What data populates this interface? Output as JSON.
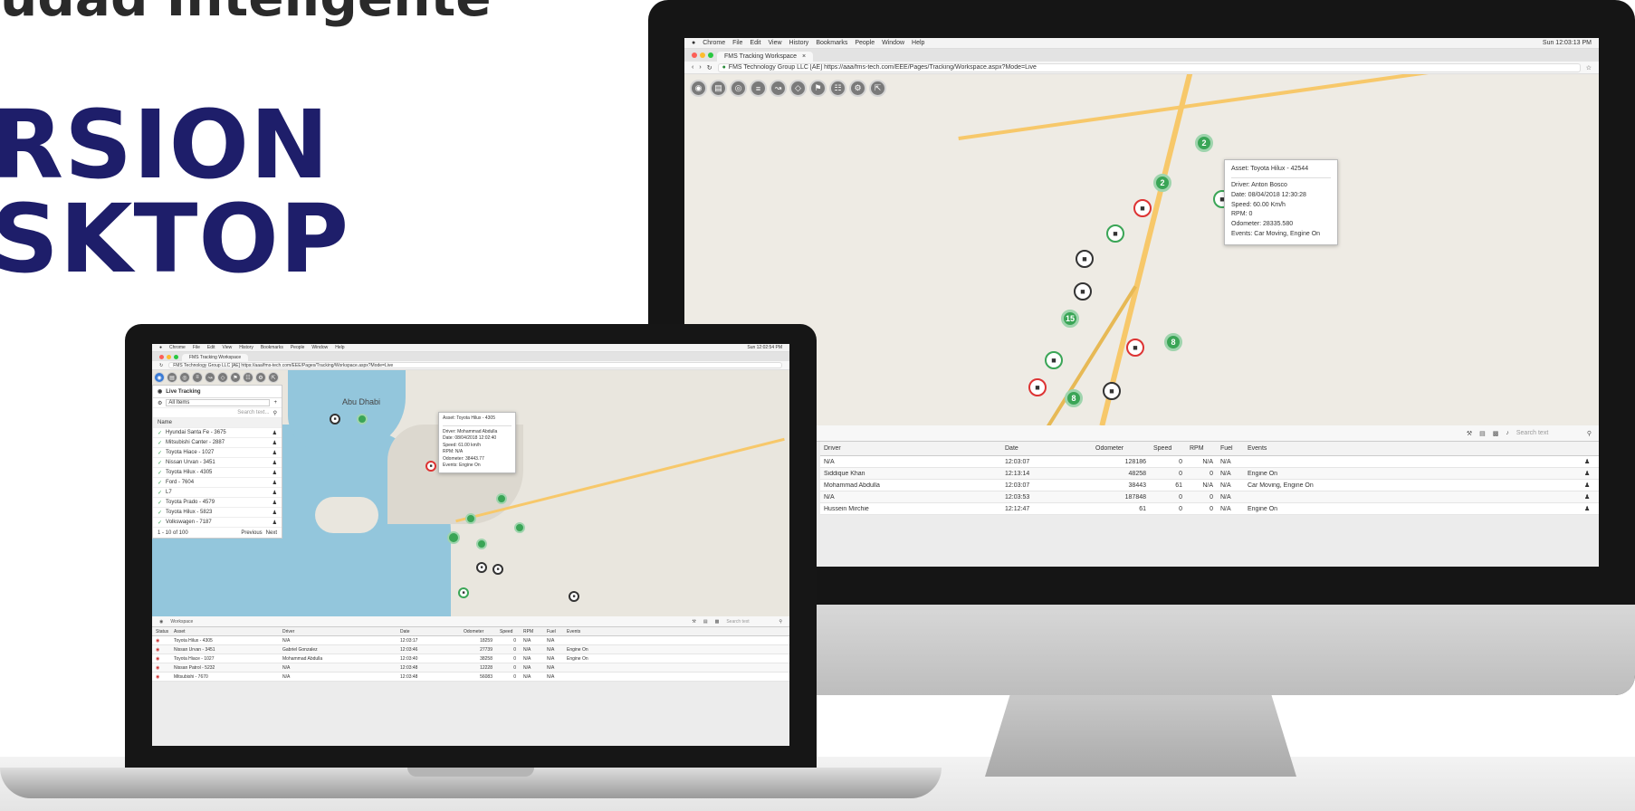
{
  "hero": {
    "top_line": "udad Inteligente",
    "line1": "RSION",
    "line2": "SKTOP"
  },
  "browser": {
    "menu": [
      "Chrome",
      "File",
      "Edit",
      "View",
      "History",
      "Bookmarks",
      "People",
      "Window",
      "Help"
    ],
    "clock_desktop": "Sun 12:03:13 PM",
    "clock_laptop": "Sun 12:02:54 PM",
    "tab_title": "FMS Tracking Workspace",
    "url_text": "FMS Technology Group LLC [AE] https://aaa/fms-tech.com/EEE/Pages/Tracking/Workspace.aspx?Mode=Live"
  },
  "toolbar": {
    "icons": [
      "map-icon",
      "layers-icon",
      "globe-icon",
      "list-icon",
      "route-icon",
      "geofence-icon",
      "poi-icon",
      "report-icon",
      "settings-icon",
      "fullscreen-icon"
    ]
  },
  "desktop_map": {
    "popup": {
      "asset": "Asset: Toyota Hilux - 42544",
      "driver": "Driver: Anton Bosco",
      "date": "Date: 08/04/2018 12:30:28",
      "speed": "Speed: 60.00 Km/h",
      "rpm": "RPM: 0",
      "odometer": "Odometer: 28335.580",
      "events": "Events: Car Moving, Engine On"
    },
    "clusters": [
      "2",
      "2",
      "15",
      "8",
      "8"
    ]
  },
  "desktop_grid": {
    "search_placeholder": "Search text",
    "columns": [
      "Driver",
      "Date",
      "Odometer",
      "Speed",
      "RPM",
      "Fuel",
      "Events"
    ],
    "rows": [
      {
        "driver": "N/A",
        "date": "12:03:07",
        "odometer": "128186",
        "speed": "0",
        "rpm": "N/A",
        "fuel": "N/A",
        "events": ""
      },
      {
        "driver": "Siddique Khan",
        "date": "12:13:14",
        "odometer": "48258",
        "speed": "0",
        "rpm": "0",
        "fuel": "N/A",
        "events": "Engine On"
      },
      {
        "driver": "Mohammad Abdulla",
        "date": "12:03:07",
        "odometer": "38443",
        "speed": "61",
        "rpm": "N/A",
        "fuel": "N/A",
        "events": "Car Moving, Engine On"
      },
      {
        "driver": "N/A",
        "date": "12:03:53",
        "odometer": "187848",
        "speed": "0",
        "rpm": "0",
        "fuel": "N/A",
        "events": ""
      },
      {
        "driver": "Hussein Mirchie",
        "date": "12:12:47",
        "odometer": "61",
        "speed": "0",
        "rpm": "0",
        "fuel": "N/A",
        "events": "Engine On"
      }
    ]
  },
  "laptop_map": {
    "city_label": "Abu Dhabi",
    "panel_title": "Live Tracking",
    "filter_value": "All Items",
    "search_placeholder": "Search text...",
    "list_header": "Name",
    "assets": [
      "Hyundai Santa Fe - 3675",
      "Mitsubishi Canter - 2887",
      "Toyota Hiace - 1027",
      "Nissan Urvan - 3451",
      "Toyota Hilux - 4305",
      "Ford - 7604",
      "L7",
      "Toyota Prado - 4579",
      "Toyota Hilux - 5823",
      "Volkswagen - 7187"
    ],
    "pager": "1 - 10 of 100",
    "prev": "Previous",
    "next": "Next",
    "popup_title": "Asset: Toyota Hilux - 4305",
    "popup_lines": [
      "Driver: Mohammad Abdulla",
      "Date: 08/04/2018 12:02:40",
      "Speed: 61.00 km/h",
      "RPM: N/A",
      "Odometer: 38443.77",
      "Events: Engine On"
    ]
  },
  "laptop_grid": {
    "title": "Workspace",
    "search_placeholder": "Search text",
    "columns": [
      "Status",
      "Asset",
      "Driver",
      "Date",
      "Odometer",
      "Speed",
      "RPM",
      "Fuel",
      "Events"
    ],
    "rows": [
      {
        "asset": "Toyota Hilux - 4305",
        "driver": "N/A",
        "date": "12:03:17",
        "odometer": "18259",
        "speed": "0",
        "rpm": "N/A",
        "fuel": "N/A",
        "events": ""
      },
      {
        "asset": "Nissan Urvan - 3451",
        "driver": "Gabriel Gonzalez",
        "date": "12:03:46",
        "odometer": "27739",
        "speed": "0",
        "rpm": "N/A",
        "fuel": "N/A",
        "events": "Engine On"
      },
      {
        "asset": "Toyota Hiace - 1027",
        "driver": "Mohammad Abdulla",
        "date": "12:03:40",
        "odometer": "38258",
        "speed": "0",
        "rpm": "N/A",
        "fuel": "N/A",
        "events": "Engine On"
      },
      {
        "asset": "Nissan Patrol - 5232",
        "driver": "N/A",
        "date": "12:03:48",
        "odometer": "12228",
        "speed": "0",
        "rpm": "N/A",
        "fuel": "N/A",
        "events": ""
      },
      {
        "asset": "Mitsubishi - 7670",
        "driver": "N/A",
        "date": "12:03:48",
        "odometer": "56083",
        "speed": "0",
        "rpm": "N/A",
        "fuel": "N/A",
        "events": ""
      }
    ]
  }
}
